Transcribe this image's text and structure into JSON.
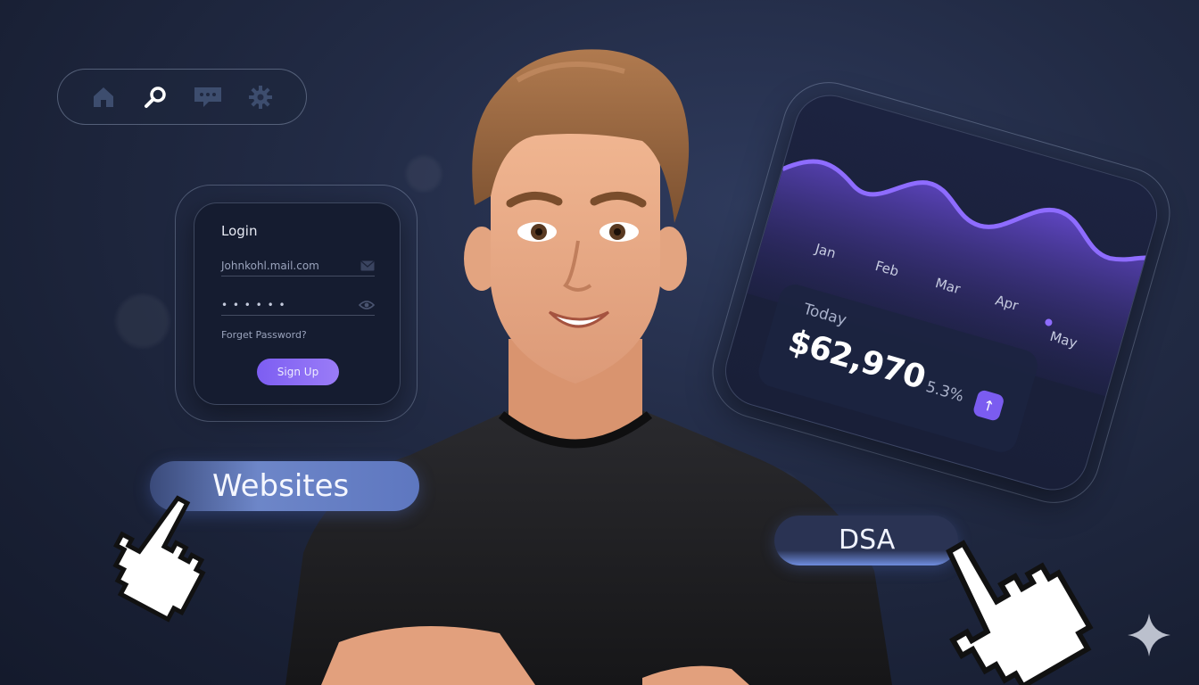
{
  "nav": {
    "icons": [
      "home-icon",
      "search-icon",
      "chat-icon",
      "gear-icon"
    ],
    "active": "search-icon"
  },
  "login": {
    "title": "Login",
    "email_value": "Johnkohl.mail.com",
    "password_value": "• • • • • •",
    "forgot_label": "Forget Password?",
    "signup_label": "Sign Up"
  },
  "chart_card": {
    "today_label": "Today",
    "amount": "$62,970",
    "change": "5.3%",
    "up_glyph": "↑"
  },
  "chart_data": {
    "type": "area",
    "categories": [
      "Jan",
      "Feb",
      "Mar",
      "Apr",
      "May"
    ],
    "grid": false,
    "legend": "none"
  },
  "labels": {
    "websites": "Websites",
    "dsa": "DSA"
  },
  "colors": {
    "accent": "#7b5cf0",
    "background": "#1c2438",
    "pill_blue": "#6d86c8"
  }
}
